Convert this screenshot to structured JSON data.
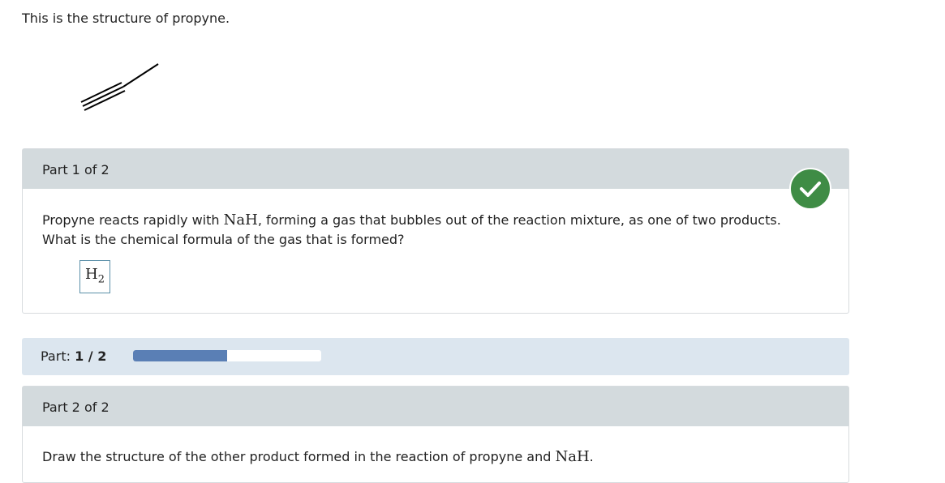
{
  "intro": {
    "text": "This is the structure of propyne."
  },
  "part1": {
    "header": "Part 1 of 2",
    "question_line1_before": "Propyne reacts rapidly with ",
    "question_chem": "NaH",
    "question_line1_after": ", forming a gas that bubbles out of the reaction mixture, as one of two products.",
    "question_line2": "What is the chemical formula of the gas that is formed?",
    "answer_base": "H",
    "answer_sub": "2",
    "status_icon": "check-icon",
    "status_color": "#3f8c45"
  },
  "progress": {
    "label": "Part:",
    "value_text": "1 / 2",
    "fraction": 0.5,
    "fill_color": "#5a7fb5"
  },
  "part2": {
    "header": "Part 2 of 2",
    "question_before": "Draw the structure of the other product formed in the reaction of propyne and ",
    "question_chem": "NaH",
    "question_after": "."
  }
}
